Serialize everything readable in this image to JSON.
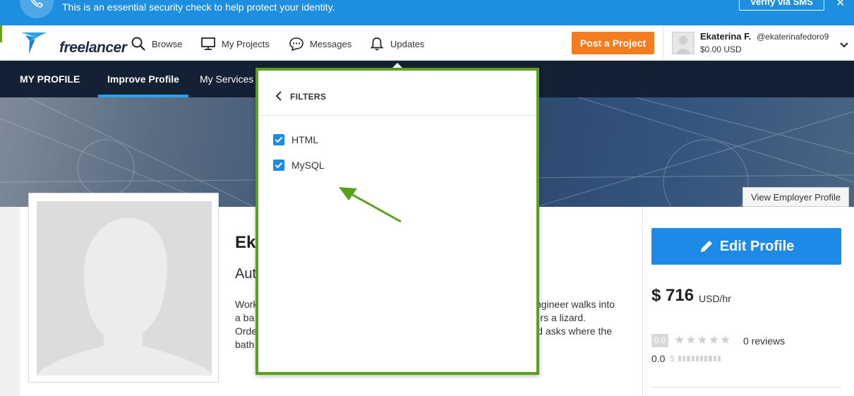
{
  "banner": {
    "text": "This is an essential security check to help protect your identity.",
    "verify_label": "Verify via SMS",
    "close_symbol": "✕"
  },
  "nav": {
    "logo_text": "freelancer",
    "items": [
      {
        "label": "Browse",
        "icon": "search-icon"
      },
      {
        "label": "My Projects",
        "icon": "monitor-icon"
      },
      {
        "label": "Messages",
        "icon": "chat-icon"
      },
      {
        "label": "Updates",
        "icon": "bell-icon"
      }
    ],
    "post_label": "Post a Project",
    "user": {
      "name": "Ekaterina F.",
      "handle": "@ekaterinafedoro9",
      "balance": "$0.00 USD"
    }
  },
  "subnav": {
    "title": "MY PROFILE",
    "tabs": [
      {
        "label": "Improve Profile",
        "active": true
      },
      {
        "label": "My Services",
        "active": false
      }
    ]
  },
  "view_employer_label": "View Employer Profile",
  "profile": {
    "name_partial": "Ek",
    "title_partial": "Aut",
    "description_lines": [
      {
        "left": "Work",
        "right": "ngineer walks into"
      },
      {
        "left": "a ba",
        "right": "rs a lizard."
      },
      {
        "left": "Orde",
        "right": "d asks where the"
      },
      {
        "left": "bath",
        "right": ""
      }
    ]
  },
  "side": {
    "edit_label": "Edit Profile",
    "rate": "$ 716",
    "rate_unit": "USD/hr",
    "score": "0.0",
    "stars": "★★★★★",
    "star_rating": 0,
    "reviews": "0 reviews",
    "earnings_score": "0.0",
    "earnings_symbol": "$",
    "earnings_level": 0
  },
  "filters": {
    "title": "FILTERS",
    "options": [
      {
        "label": "HTML",
        "checked": true
      },
      {
        "label": "MySQL",
        "checked": true
      }
    ]
  },
  "colors": {
    "banner": "#1e8fe0",
    "post_button": "#f57c1f",
    "subnav": "#142033",
    "tab_accent": "#29a3ea",
    "edit_button": "#1c8ae6",
    "highlight": "#5b9f1e"
  }
}
